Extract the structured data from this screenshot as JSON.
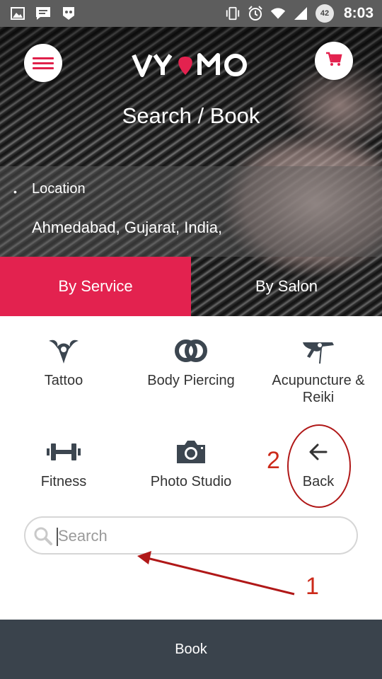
{
  "status_bar": {
    "time": "8:03",
    "battery_level": "42",
    "left_icons": [
      "image-icon",
      "message-icon",
      "app-notification-icon"
    ],
    "right_icons": [
      "vibrate-icon",
      "alarm-icon",
      "wifi-icon",
      "signal-icon",
      "battery-icon"
    ]
  },
  "header": {
    "logo_text": "vyomo",
    "title": "Search / Book",
    "menu_icon": "hamburger-menu-icon",
    "cart_icon": "shopping-cart-icon"
  },
  "location": {
    "label": "Location",
    "value": "Ahmedabad, Gujarat, India,"
  },
  "tabs": [
    {
      "label": "By Service",
      "active": true
    },
    {
      "label": "By Salon",
      "active": false
    }
  ],
  "categories": [
    {
      "label": "Tattoo",
      "icon": "tattoo-icon"
    },
    {
      "label": "Body Piercing",
      "icon": "body-piercing-icon"
    },
    {
      "label": "Acupuncture & Reiki",
      "icon": "acupuncture-icon"
    },
    {
      "label": "Fitness",
      "icon": "dumbbell-icon"
    },
    {
      "label": "Photo Studio",
      "icon": "camera-icon"
    },
    {
      "label": "Back",
      "icon": "back-arrow-icon"
    }
  ],
  "search": {
    "placeholder": "Search",
    "value": ""
  },
  "annotations": {
    "label_1": "1",
    "label_2": "2"
  },
  "bottom_button": {
    "label": "Book"
  },
  "colors": {
    "accent": "#e3224f",
    "bottom_bar": "#3a434c",
    "annotation": "#cc2a1a",
    "status_bar": "#5d5d5d"
  }
}
